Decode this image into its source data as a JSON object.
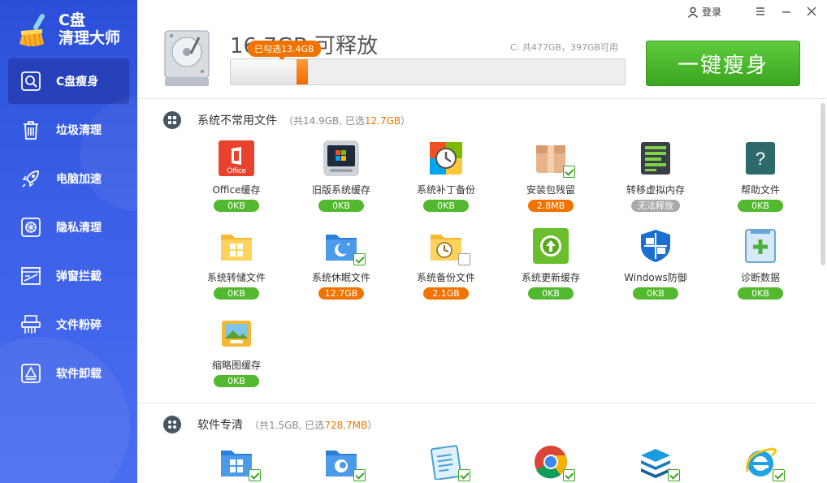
{
  "app": {
    "name_line1": "C盘",
    "name_line2": "清理大师"
  },
  "sidebar": {
    "items": [
      {
        "label": "C盘瘦身",
        "icon": "disk-search-icon",
        "active": true
      },
      {
        "label": "垃圾清理",
        "icon": "trash-icon"
      },
      {
        "label": "电脑加速",
        "icon": "rocket-icon"
      },
      {
        "label": "隐私清理",
        "icon": "privacy-icon"
      },
      {
        "label": "弹窗拦截",
        "icon": "popup-block-icon"
      },
      {
        "label": "文件粉碎",
        "icon": "shredder-icon"
      },
      {
        "label": "软件卸载",
        "icon": "uninstall-icon"
      }
    ]
  },
  "topbar": {
    "login_label": "登录"
  },
  "header": {
    "free_title": "16.7GB 可释放",
    "selected_tip": "已勾选13.4GB",
    "disk_info": "C: 共477GB，397GB可用",
    "used_fraction": 0.168,
    "selected_fraction": 0.028,
    "slim_button": "一键瘦身"
  },
  "sections": [
    {
      "title": "系统不常用文件",
      "meta_prefix": "（共14.9GB, 已选",
      "meta_selected": "12.7GB",
      "meta_suffix": "）",
      "items": [
        {
          "label": "Office缓存",
          "value": "0KB",
          "badge": "green",
          "icon": "office-icon",
          "check": "none"
        },
        {
          "label": "旧版系统缓存",
          "value": "0KB",
          "badge": "green",
          "icon": "old-system-icon",
          "check": "none"
        },
        {
          "label": "系统补丁备份",
          "value": "0KB",
          "badge": "green",
          "icon": "patch-backup-icon",
          "check": "none"
        },
        {
          "label": "安装包残留",
          "value": "2.8MB",
          "badge": "orange",
          "icon": "package-icon",
          "check": "on"
        },
        {
          "label": "转移虚拟内存",
          "value": "无法释放",
          "badge": "gray",
          "icon": "memory-icon",
          "check": "none"
        },
        {
          "label": "帮助文件",
          "value": "0KB",
          "badge": "green",
          "icon": "help-icon",
          "check": "none"
        },
        {
          "label": "系统转储文件",
          "value": "0KB",
          "badge": "green",
          "icon": "dump-folder-icon",
          "check": "none"
        },
        {
          "label": "系统休眠文件",
          "value": "12.7GB",
          "badge": "orange",
          "icon": "hibernate-icon",
          "check": "on"
        },
        {
          "label": "系统备份文件",
          "value": "2.1GB",
          "badge": "orange",
          "icon": "backup-folder-icon",
          "check": "off"
        },
        {
          "label": "系统更新缓存",
          "value": "0KB",
          "badge": "green",
          "icon": "update-icon",
          "check": "none"
        },
        {
          "label": "Windows防御",
          "value": "0KB",
          "badge": "green",
          "icon": "shield-icon",
          "check": "none"
        },
        {
          "label": "诊断数据",
          "value": "0KB",
          "badge": "green",
          "icon": "diagnostic-icon",
          "check": "none"
        },
        {
          "label": "缩略图缓存",
          "value": "0KB",
          "badge": "green",
          "icon": "thumbnail-icon",
          "check": "none"
        }
      ]
    },
    {
      "title": "软件专清",
      "meta_prefix": "（共1.5GB, 已选",
      "meta_selected": "728.7MB",
      "meta_suffix": "）",
      "items": [
        {
          "icon": "windows-folder-icon",
          "check": "on"
        },
        {
          "icon": "edge-folder-icon",
          "check": "on"
        },
        {
          "icon": "notes-icon",
          "check": "on"
        },
        {
          "icon": "chrome-icon",
          "check": "on"
        },
        {
          "icon": "layers-icon",
          "check": "on"
        },
        {
          "icon": "ie-icon",
          "check": "on"
        }
      ]
    }
  ],
  "colors": {
    "sidebar": "#2b4fd8",
    "accent_green": "#52b82e",
    "accent_orange": "#f07300"
  }
}
